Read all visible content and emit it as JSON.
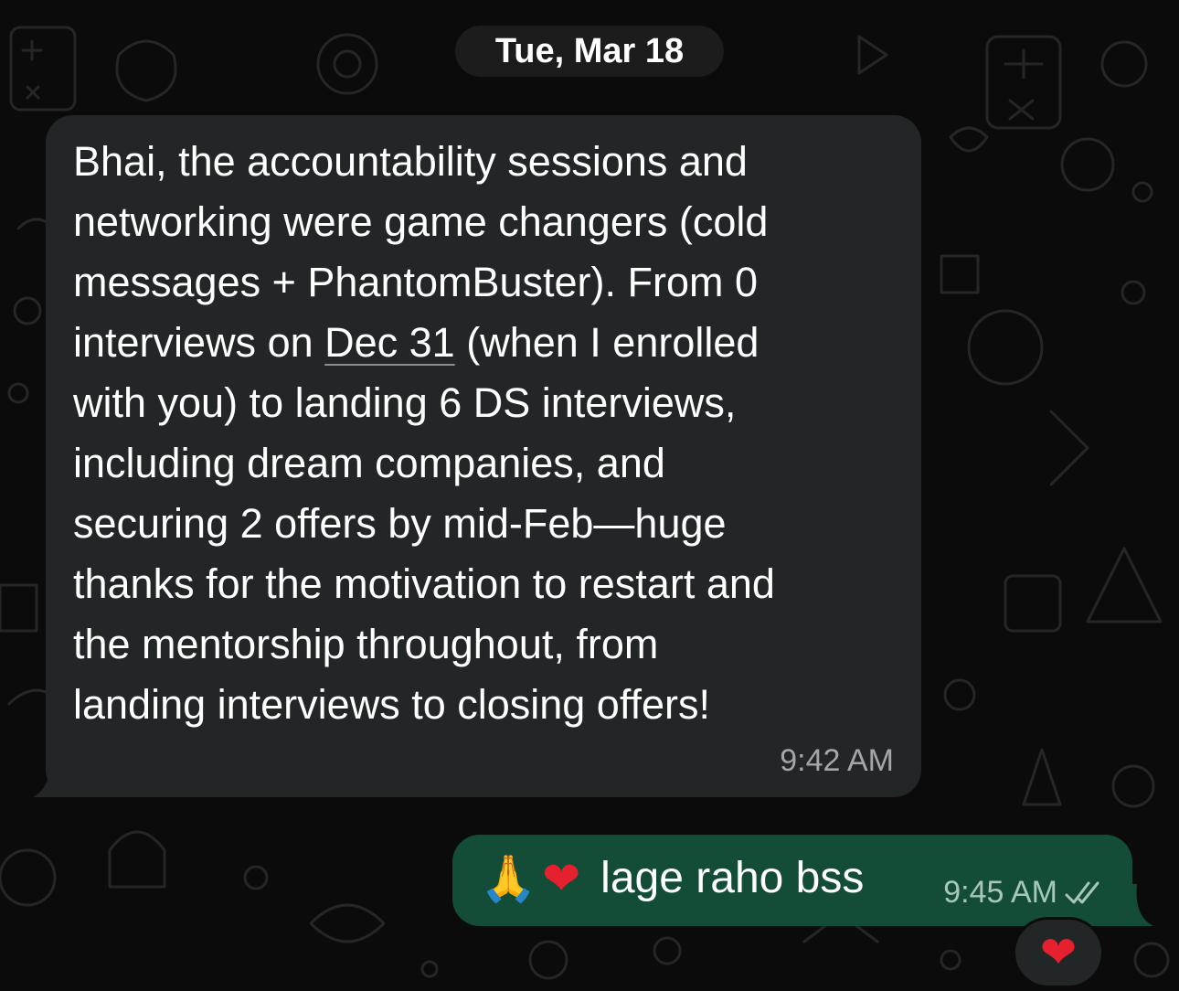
{
  "chat": {
    "date_separator": "Tue, Mar 18",
    "incoming": {
      "text_before_link": "Bhai, the accountability sessions and\nnetworking were game changers (cold\nmessages + PhantomBuster). From 0\ninterviews on ",
      "link_text": "Dec 31",
      "text_after_link": " (when I enrolled\nwith you) to landing 6 DS interviews,\nincluding dream companies, and\nsecuring 2 offers by mid-Feb—huge\nthanks for the motivation to restart and\nthe mentorship throughout, from\nlanding interviews to closing offers!",
      "time": "9:42 AM"
    },
    "outgoing": {
      "emoji_1": "🙏",
      "emoji_2": "❤",
      "text": "lage raho bss",
      "time": "9:45 AM",
      "status_icon": "double-check-icon"
    },
    "reaction": {
      "emoji": "❤",
      "icon": "heart-reaction-icon"
    }
  },
  "colors": {
    "background": "#0b0b0b",
    "incoming_bubble": "#232626",
    "outgoing_bubble": "#144d37",
    "date_pill": "#1c1c1d",
    "heart": "#e5202f"
  }
}
